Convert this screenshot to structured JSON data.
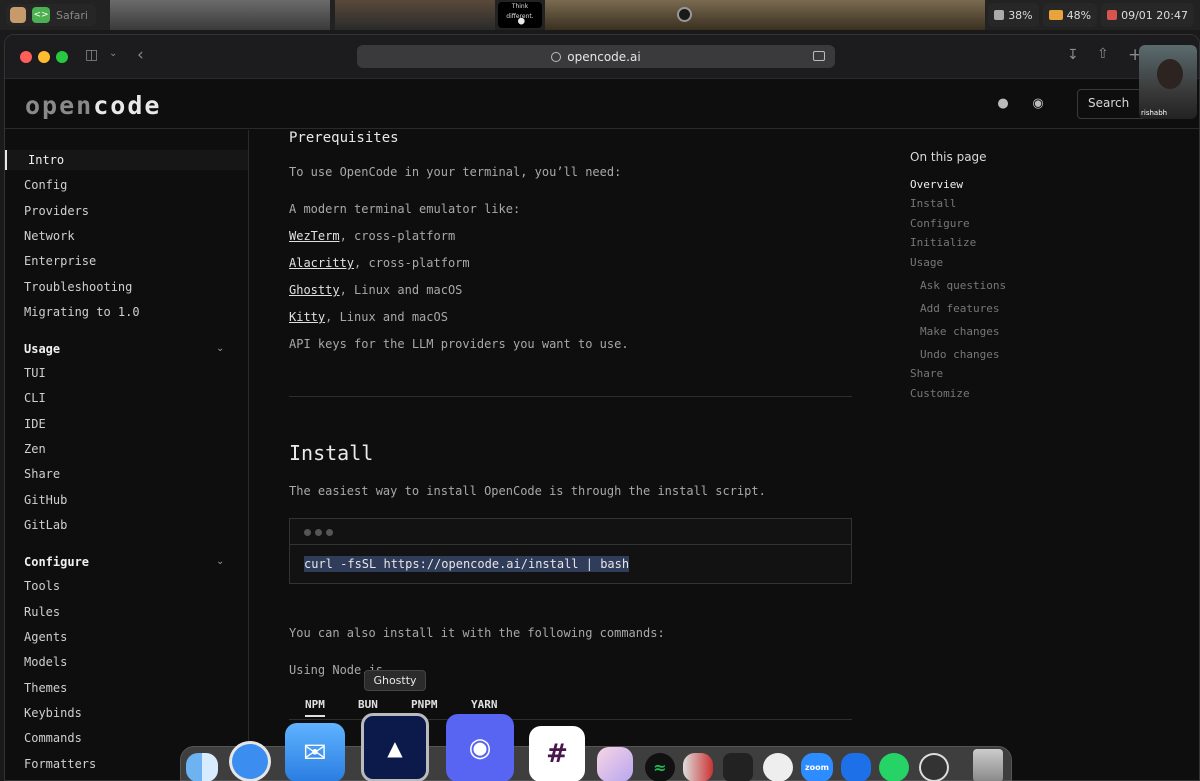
{
  "menubar": {
    "app_name": "Safari",
    "apple_tagline": "Think different.",
    "volume": "38%",
    "battery": "48%",
    "datetime": "09/01 20:47"
  },
  "browser": {
    "url": "opencode.ai"
  },
  "site": {
    "logo_main": "open",
    "logo_accent": "code",
    "search_label": "Search"
  },
  "webcam": {
    "name": "rishabh"
  },
  "sidebar": {
    "items": [
      "Intro",
      "Config",
      "Providers",
      "Network",
      "Enterprise",
      "Troubleshooting",
      "Migrating to 1.0"
    ],
    "groups": [
      {
        "label": "Usage",
        "items": [
          "TUI",
          "CLI",
          "IDE",
          "Zen",
          "Share",
          "GitHub",
          "GitLab"
        ]
      },
      {
        "label": "Configure",
        "items": [
          "Tools",
          "Rules",
          "Agents",
          "Models",
          "Themes",
          "Keybinds",
          "Commands",
          "Formatters"
        ]
      }
    ]
  },
  "content": {
    "prereq_heading": "Prerequisites",
    "prereq_intro": "To use OpenCode in your terminal, you’ll need:",
    "terminal_intro": "A modern terminal emulator like:",
    "terminals": [
      {
        "name": "WezTerm",
        "desc": ", cross-platform"
      },
      {
        "name": "Alacritty",
        "desc": ", cross-platform"
      },
      {
        "name": "Ghostty",
        "desc": ", Linux and macOS"
      },
      {
        "name": "Kitty",
        "desc": ", Linux and macOS"
      }
    ],
    "api_keys": "API keys for the LLM providers you want to use.",
    "install_heading": "Install",
    "install_intro": "The easiest way to install OpenCode is through the install script.",
    "install_command": "curl -fsSL https://opencode.ai/install | bash",
    "also_install": "You can also install it with the following commands:",
    "using_node": "Using Node.js",
    "pkg_tabs": [
      "NPM",
      "BUN",
      "PNPM",
      "YARN"
    ]
  },
  "toc": {
    "title": "On this page",
    "items": [
      "Overview",
      "Install",
      "Configure",
      "Initialize",
      "Usage",
      "Ask questions",
      "Add features",
      "Make changes",
      "Undo changes",
      "Share",
      "Customize"
    ]
  },
  "dock": {
    "tooltip": "Ghostty",
    "apps": [
      "finder-icon",
      "safari-icon",
      "mail-icon",
      "ghostty-icon",
      "discord-icon",
      "slack-icon",
      "claude-icon",
      "spotify-icon",
      "git-icon",
      "cursor-icon",
      "linear-icon",
      "zoom-icon",
      "keynote-icon",
      "whatsapp-icon",
      "obs-icon",
      "trash-icon"
    ],
    "zoom_label": "zoom"
  },
  "colors": {
    "background": "#0e0e0e",
    "text": "#cfcfcf",
    "muted": "#a8a8a8",
    "selection": "#2f3d5a"
  }
}
